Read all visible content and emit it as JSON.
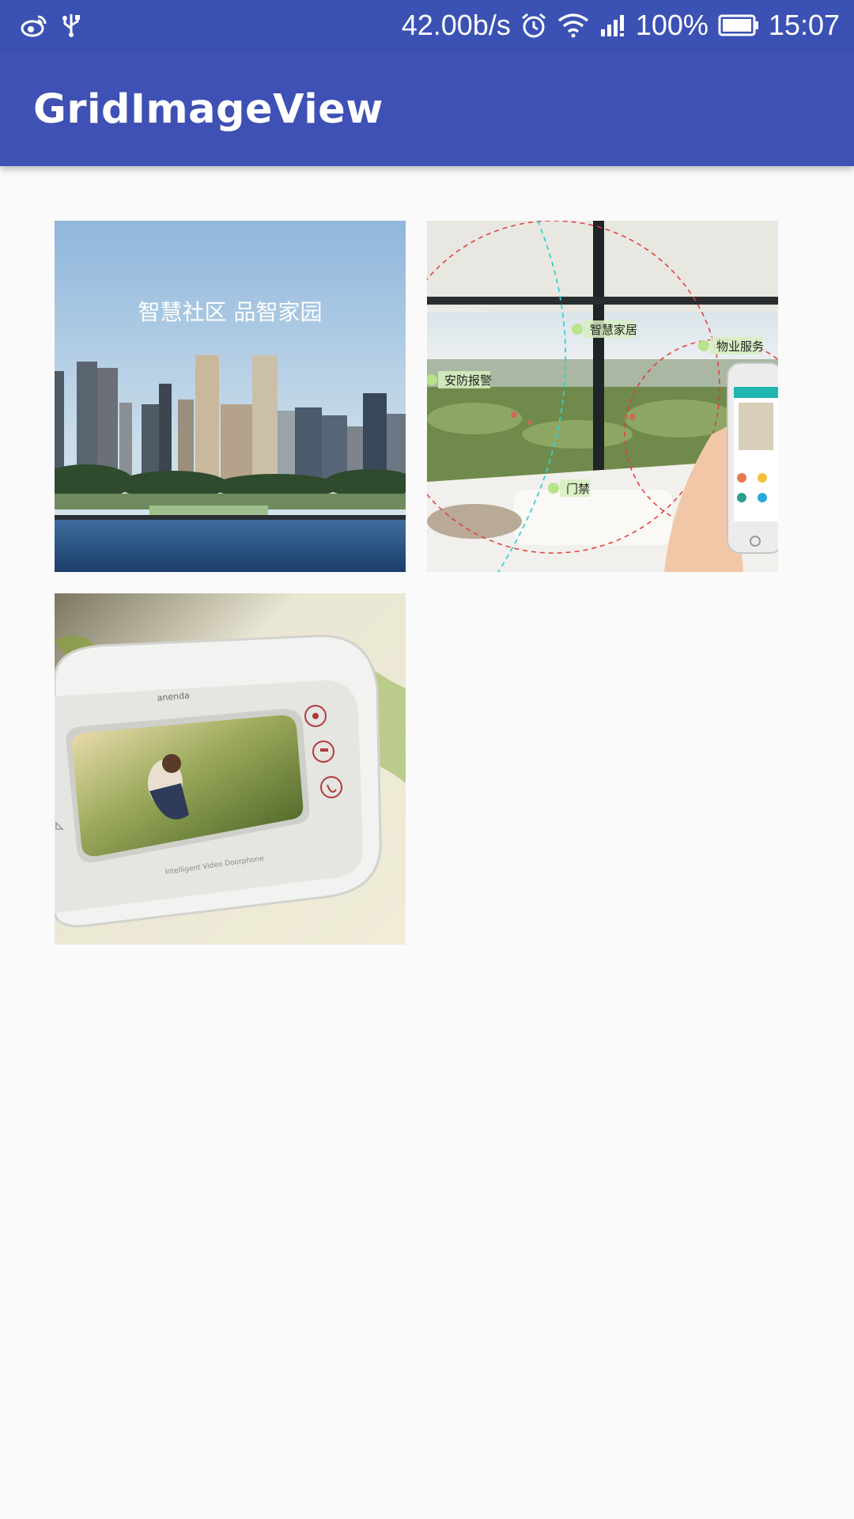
{
  "status_bar": {
    "network_speed": "42.00b/s",
    "battery_percent": "100%",
    "time": "15:07",
    "left_icons": [
      "weibo-icon",
      "usb-icon"
    ],
    "right_icons": [
      "alarm-icon",
      "wifi-icon",
      "signal-icon",
      "battery-icon"
    ],
    "color": "#3b52b4"
  },
  "app_bar": {
    "title": "GridImageView",
    "color": "#3f51b5"
  },
  "images": [
    {
      "overlay_text": "智慧社区  品智家园"
    },
    {
      "labels": [
        "智慧家居",
        "物业服务",
        "安防报警",
        "门禁"
      ]
    },
    {
      "brand": "anenda",
      "caption": "Intelligent Video Doorphone"
    }
  ]
}
